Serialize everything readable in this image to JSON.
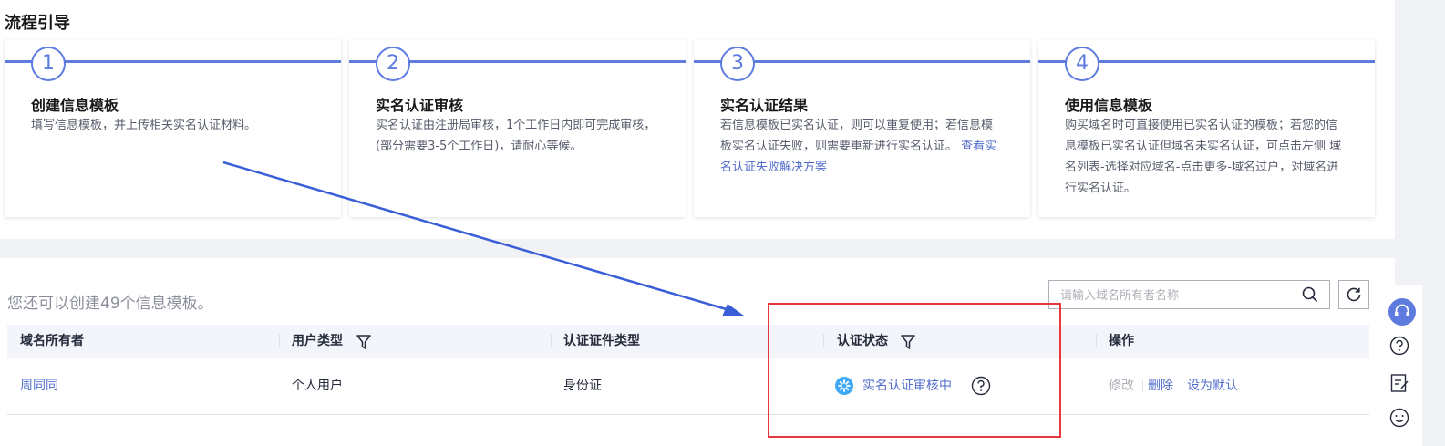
{
  "guide": {
    "title": "流程引导",
    "steps": [
      {
        "number": "1",
        "title": "创建信息模板",
        "desc": "填写信息模板，并上传相关实名认证材料。"
      },
      {
        "number": "2",
        "title": "实名认证审核",
        "desc": "实名认证由注册局审核，1个工作日内即可完成审核，(部分需要3-5个工作日)，请耐心等候。"
      },
      {
        "number": "3",
        "title": "实名认证结果",
        "desc": "若信息模板已实名认证，则可以重复使用；若信息模板实名认证失败，则需要重新进行实名认证。",
        "link": "查看实名认证失败解决方案"
      },
      {
        "number": "4",
        "title": "使用信息模板",
        "desc": "购买域名时可直接使用已实名认证的模板；若您的信息模板已实名认证但域名未实名认证，可点击左侧 域名列表-选择对应域名-点击更多-域名过户，对域名进行实名认证。"
      }
    ]
  },
  "list": {
    "count_text": "您还可以创建49个信息模板。",
    "search_placeholder": "请输入域名所有者名称",
    "columns": [
      "域名所有者",
      "用户类型",
      "认证证件类型",
      "认证状态",
      "操作"
    ],
    "rows": [
      {
        "owner": "周同同",
        "user_type": "个人用户",
        "id_type": "身份证",
        "status": "实名认证审核中",
        "actions": [
          "修改",
          "删除",
          "设为默认"
        ]
      }
    ]
  },
  "icons": {
    "search": "search-icon",
    "refresh": "refresh-icon",
    "filter": "filter-icon",
    "status": "loading-icon",
    "help": "help-icon",
    "sidebar": [
      "customer-service-icon",
      "help-icon",
      "feedback-icon",
      "smile-icon"
    ]
  },
  "colors": {
    "accent": "#5e7ce0",
    "link": "#526ecc",
    "annotation_red": "#e8383d",
    "annotation_arrow": "#3a5ed8",
    "status_icon": "#3fa9f5"
  }
}
